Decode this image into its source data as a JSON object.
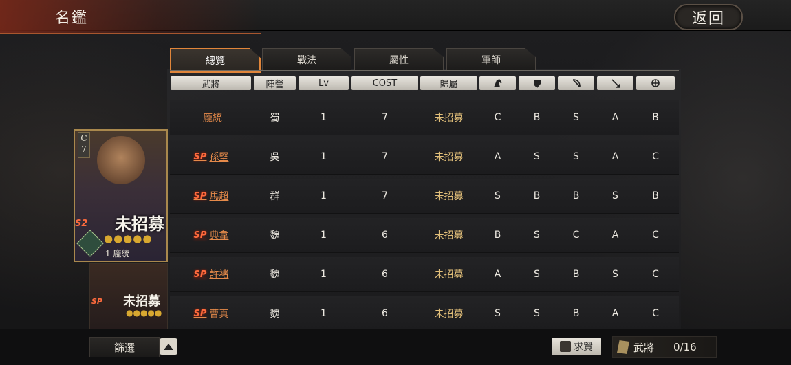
{
  "header": {
    "title": "名鑑",
    "back_label": "返回"
  },
  "tabs": [
    {
      "label": "總覽",
      "active": true
    },
    {
      "label": "戰法",
      "active": false
    },
    {
      "label": "屬性",
      "active": false
    },
    {
      "label": "軍師",
      "active": false
    }
  ],
  "columns": {
    "general": "武將",
    "faction": "陣營",
    "lv": "Lv",
    "cost": "COST",
    "belong": "歸屬",
    "cavalry_icon": "cavalry-icon",
    "shield_icon": "shield-icon",
    "bow_icon": "bow-icon",
    "spear_icon": "spear-icon",
    "siege_icon": "siege-icon"
  },
  "rows": [
    {
      "sp": "",
      "name": "龐統",
      "faction": "蜀",
      "lv": "1",
      "cost": "7",
      "belong": "未招募",
      "a": "C",
      "b": "B",
      "c": "S",
      "d": "A",
      "e": "B"
    },
    {
      "sp": "SP",
      "name": "孫堅",
      "faction": "吳",
      "lv": "1",
      "cost": "7",
      "belong": "未招募",
      "a": "A",
      "b": "S",
      "c": "S",
      "d": "A",
      "e": "C"
    },
    {
      "sp": "SP",
      "name": "馬超",
      "faction": "群",
      "lv": "1",
      "cost": "7",
      "belong": "未招募",
      "a": "S",
      "b": "B",
      "c": "B",
      "d": "S",
      "e": "B"
    },
    {
      "sp": "SP",
      "name": "典韋",
      "faction": "魏",
      "lv": "1",
      "cost": "6",
      "belong": "未招募",
      "a": "B",
      "b": "S",
      "c": "C",
      "d": "A",
      "e": "C"
    },
    {
      "sp": "SP",
      "name": "許褚",
      "faction": "魏",
      "lv": "1",
      "cost": "6",
      "belong": "未招募",
      "a": "A",
      "b": "S",
      "c": "B",
      "d": "S",
      "e": "C"
    },
    {
      "sp": "SP",
      "name": "曹真",
      "faction": "魏",
      "lv": "1",
      "cost": "6",
      "belong": "未招募",
      "a": "S",
      "b": "S",
      "c": "B",
      "d": "A",
      "e": "C"
    }
  ],
  "card": {
    "cost_letter": "C",
    "cost_value": "7",
    "stamp": "未招募",
    "sp_tag": "S2",
    "badge": "蜀",
    "level_name": "1 龐統",
    "stars": "●●●●●"
  },
  "card2": {
    "stamp": "未招募",
    "sp_tag": "SP",
    "stars": "●●●●●"
  },
  "footer": {
    "filter_label": "篩選",
    "recruit_label": "求賢",
    "generals_label": "武將",
    "generals_count": "0/16"
  }
}
